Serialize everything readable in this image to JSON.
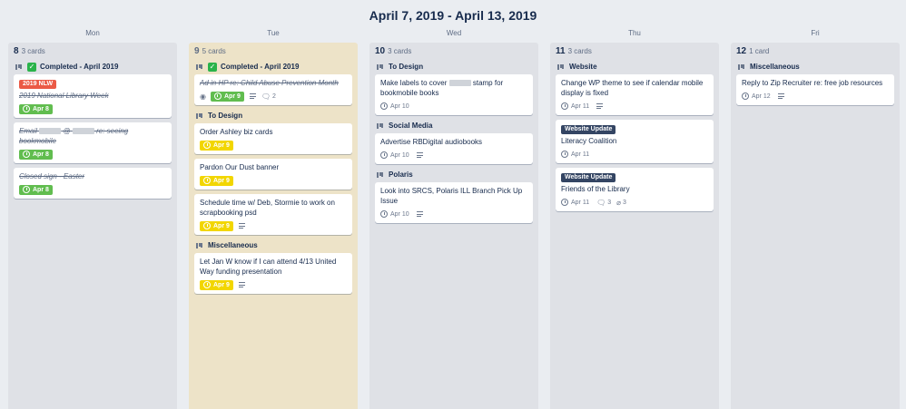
{
  "week_title": "April 7, 2019 - April 13, 2019",
  "days": [
    "Mon",
    "Tue",
    "Wed",
    "Thu",
    "Fri"
  ],
  "columns": [
    {
      "date": "8",
      "count": "3 cards",
      "groups": [
        {
          "title": "Completed - April 2019",
          "completed_mark": true,
          "cards": [
            {
              "label": "2019 NLW",
              "label_color": "#eb5a46",
              "text": "2019 National Library Week",
              "done": true,
              "due": "Apr 8",
              "due_style": "green"
            },
            {
              "text_parts": [
                "Email",
                "@",
                "re: seeing bookmobile"
              ],
              "text": "Email @ re: seeing bookmobile",
              "done": true,
              "due": "Apr 8",
              "due_style": "green"
            },
            {
              "text": "Closed sign - Easter",
              "done": true,
              "due": "Apr 8",
              "due_style": "green"
            }
          ]
        }
      ]
    },
    {
      "date": "9",
      "count": "5 cards",
      "groups": [
        {
          "title": "Completed - April 2019",
          "completed_mark": true,
          "cards": [
            {
              "text": "Ad in HP re: Child Abuse Prevention Month",
              "done": true,
              "due": "Apr 9",
              "due_style": "green",
              "watch": true,
              "desc": true,
              "comments": "2"
            }
          ]
        },
        {
          "title": "To Design",
          "cards": [
            {
              "text": "Order Ashley biz cards",
              "due": "Apr 9",
              "due_style": "yellow"
            },
            {
              "text": "Pardon Our Dust banner",
              "due": "Apr 9",
              "due_style": "yellow"
            },
            {
              "text": "Schedule time w/ Deb, Stormie to work on scrapbooking psd",
              "due": "Apr 9",
              "due_style": "yellow",
              "desc": true
            }
          ]
        },
        {
          "title": "Miscellaneous",
          "cards": [
            {
              "text": "Let Jan W know if I can attend 4/13 United Way funding presentation",
              "due": "Apr 9",
              "due_style": "yellow",
              "desc": true
            }
          ]
        }
      ]
    },
    {
      "date": "10",
      "count": "3 cards",
      "groups": [
        {
          "title": "To Design",
          "cards": [
            {
              "text_parts": [
                "Make labels to cover",
                "stamp for bookmobile books"
              ],
              "text": "Make labels to cover stamp for bookmobile books",
              "due": "Apr 10",
              "due_style": "plain"
            }
          ]
        },
        {
          "title": "Social Media",
          "cards": [
            {
              "text": "Advertise RBDigital audiobooks",
              "due": "Apr 10",
              "due_style": "plain",
              "desc": true
            }
          ]
        },
        {
          "title": "Polaris",
          "cards": [
            {
              "text": "Look into SRCS, Polaris ILL Branch Pick Up Issue",
              "due": "Apr 10",
              "due_style": "plain",
              "desc": true
            }
          ]
        }
      ]
    },
    {
      "date": "11",
      "count": "3 cards",
      "groups": [
        {
          "title": "Website",
          "cards": [
            {
              "text": "Change WP theme to see if calendar mobile display is fixed",
              "due": "Apr 11",
              "due_style": "plain",
              "desc": true
            },
            {
              "label": "Website Update",
              "label_color": "#344563",
              "text": "Literacy Coalition",
              "due": "Apr 11",
              "due_style": "plain"
            },
            {
              "label": "Website Update",
              "label_color": "#344563",
              "text": "Friends of the Library",
              "due": "Apr 11",
              "due_style": "plain",
              "comments": "3",
              "attachments": "3"
            }
          ]
        }
      ]
    },
    {
      "date": "12",
      "count": "1 card",
      "groups": [
        {
          "title": "Miscellaneous",
          "cards": [
            {
              "text": "Reply to Zip Recruiter re: free job resources",
              "due": "Apr 12",
              "due_style": "plain",
              "desc": true
            }
          ]
        }
      ]
    }
  ],
  "today_color": "#ede3c8",
  "icons": {
    "board": "board-icon",
    "check": "check-icon",
    "clock": "clock-icon",
    "description": "description-icon",
    "watch": "eye-icon",
    "comment": "comment-icon",
    "attachment": "paperclip-icon"
  }
}
